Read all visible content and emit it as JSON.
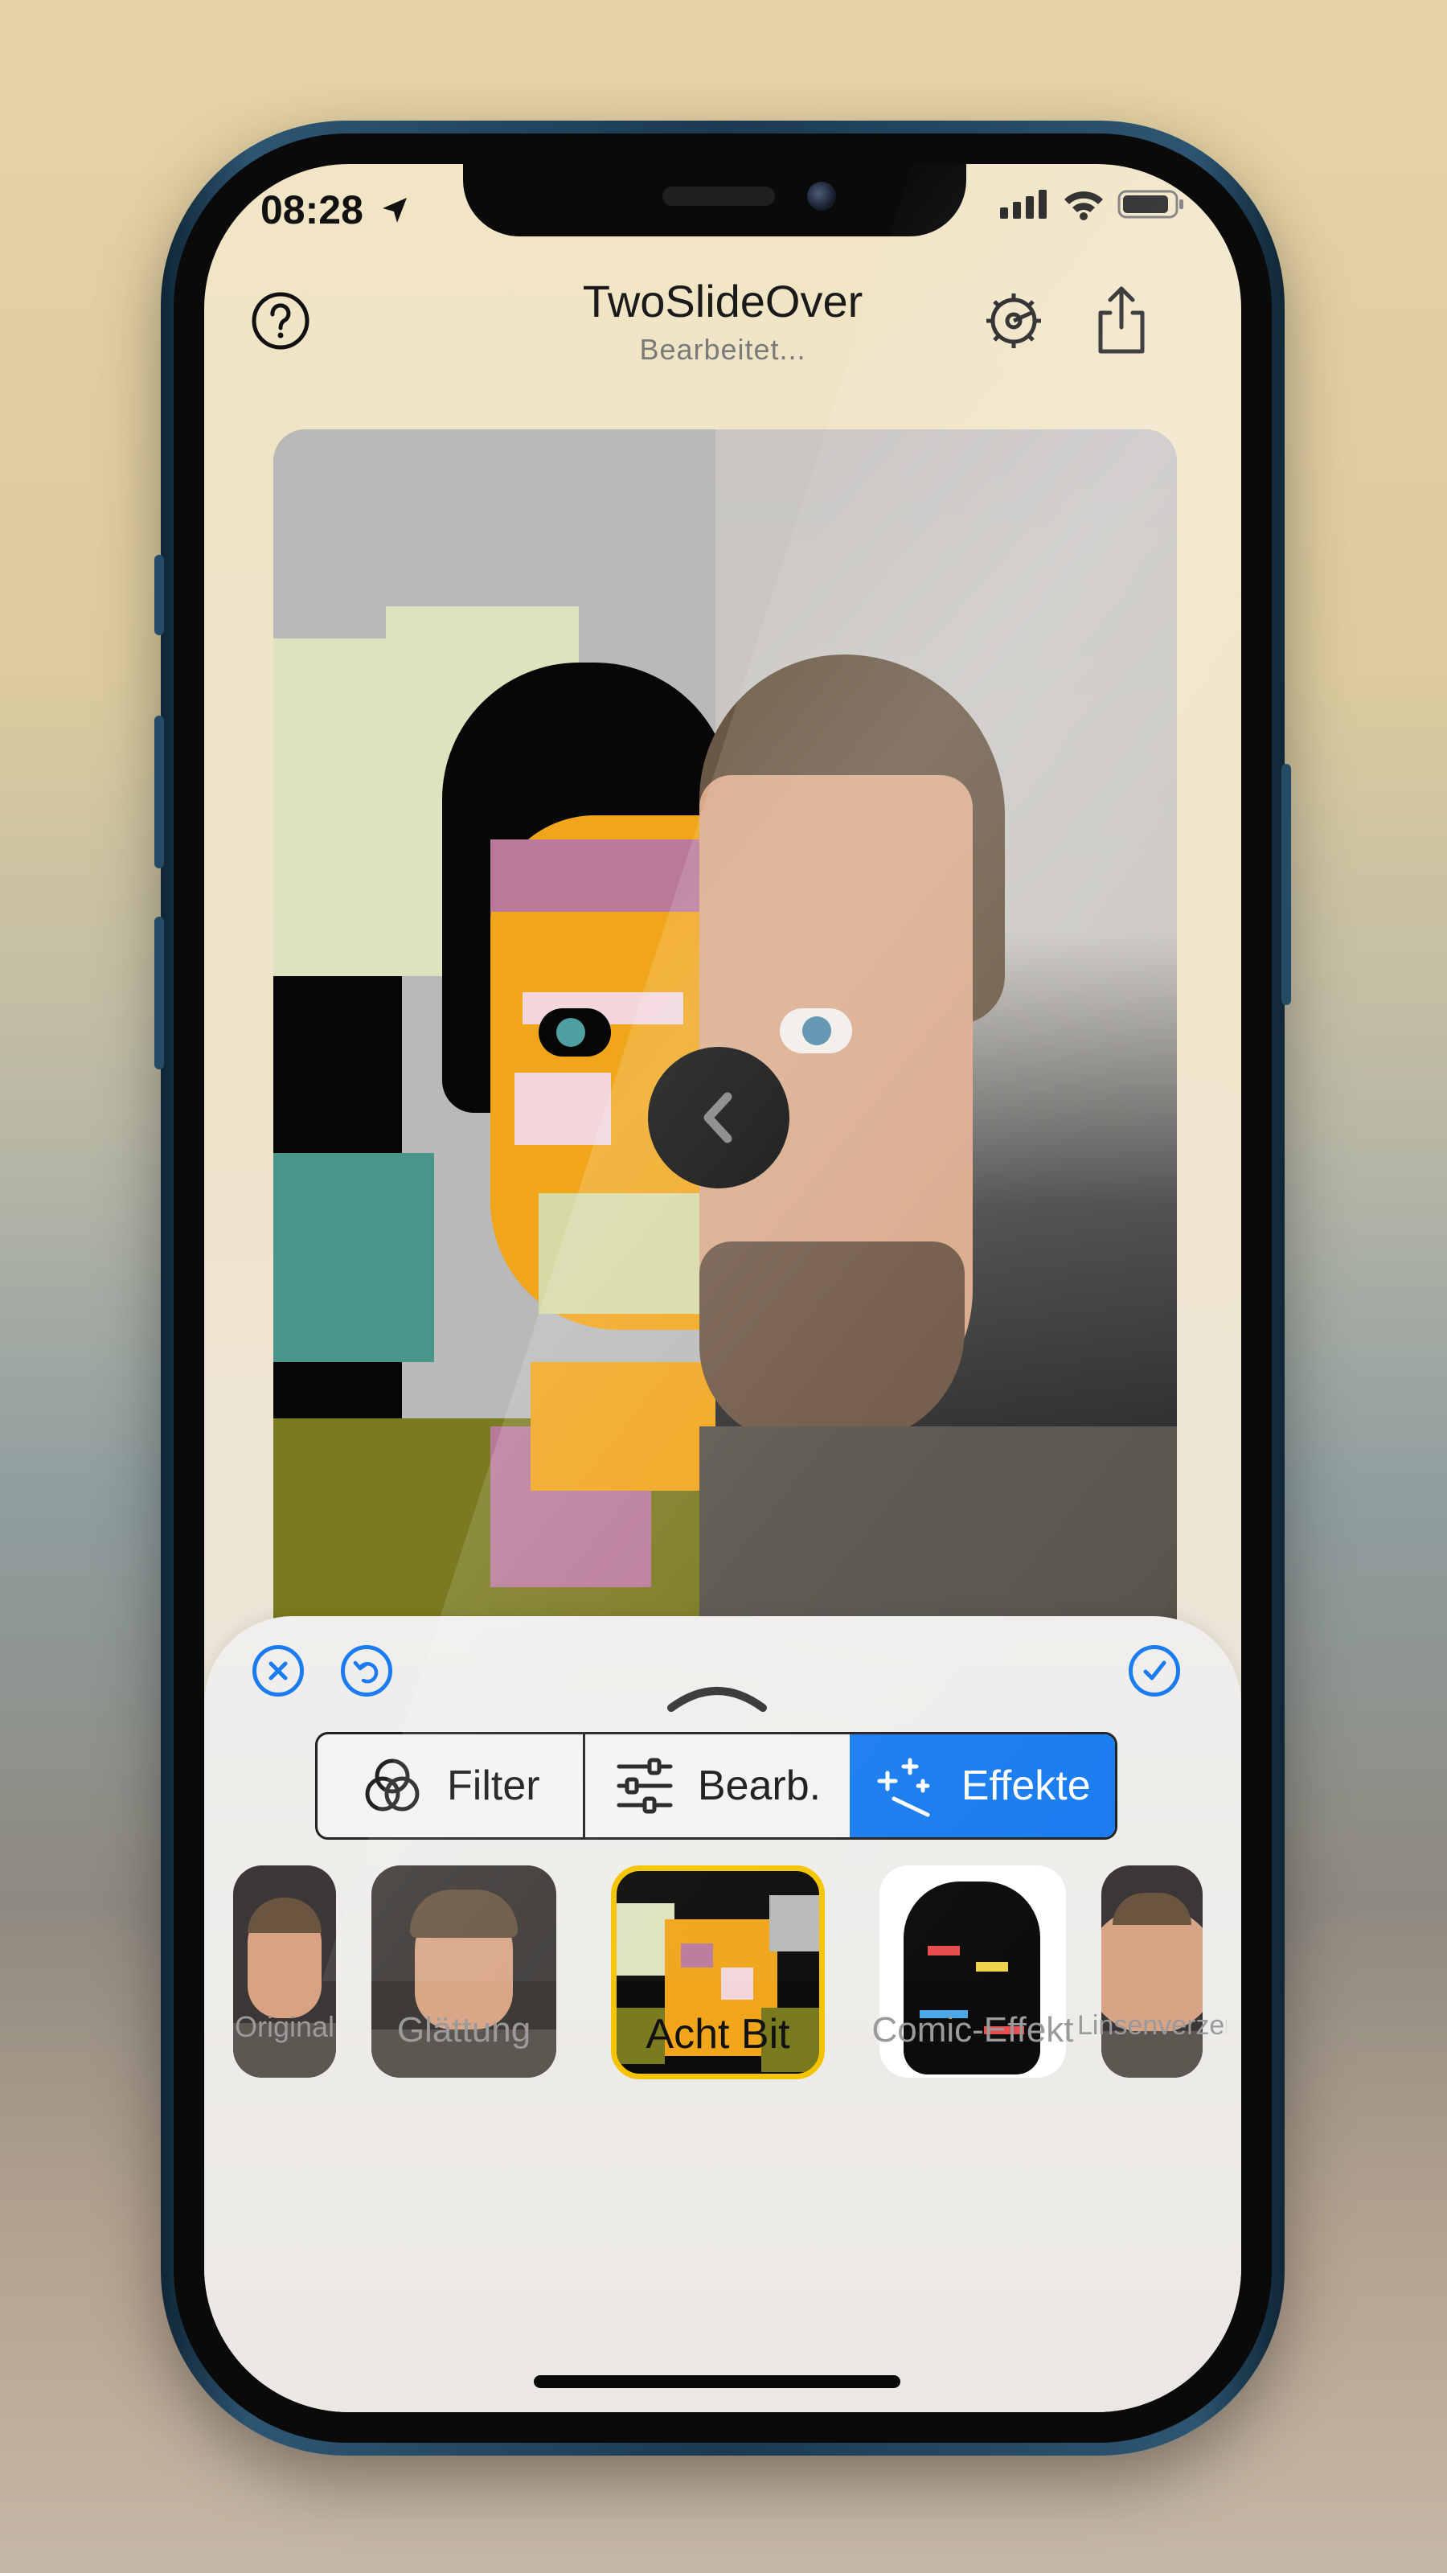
{
  "status_bar": {
    "time": "08:28"
  },
  "nav": {
    "title": "TwoSlideOver",
    "subtitle": "Bearbeitet...",
    "help_icon": "question-circle-icon",
    "settings_icon": "gear-icon",
    "share_icon": "share-icon"
  },
  "editor": {
    "slider_icon": "chevron-left-icon",
    "cancel_icon": "xmark-circle-icon",
    "undo_icon": "undo-circle-icon",
    "confirm_icon": "checkmark-circle-icon",
    "collapse_icon": "chevron-up-icon"
  },
  "segments": [
    {
      "label": "Filter",
      "icon": "overlapping-circles-icon",
      "active": false
    },
    {
      "label": "Bearb.",
      "icon": "sliders-icon",
      "active": false
    },
    {
      "label": "Effekte",
      "icon": "magic-wand-icon",
      "active": true
    }
  ],
  "effects": [
    {
      "label": "Original"
    },
    {
      "label": "Glättung"
    },
    {
      "label": "Acht Bit",
      "selected": true
    },
    {
      "label": "Comic-Effekt"
    },
    {
      "label": "Linsenverzerrung"
    }
  ],
  "colors": {
    "accent": "#1a7cf0",
    "selected_outline": "#f5c400",
    "frame": "#1b3a52"
  }
}
